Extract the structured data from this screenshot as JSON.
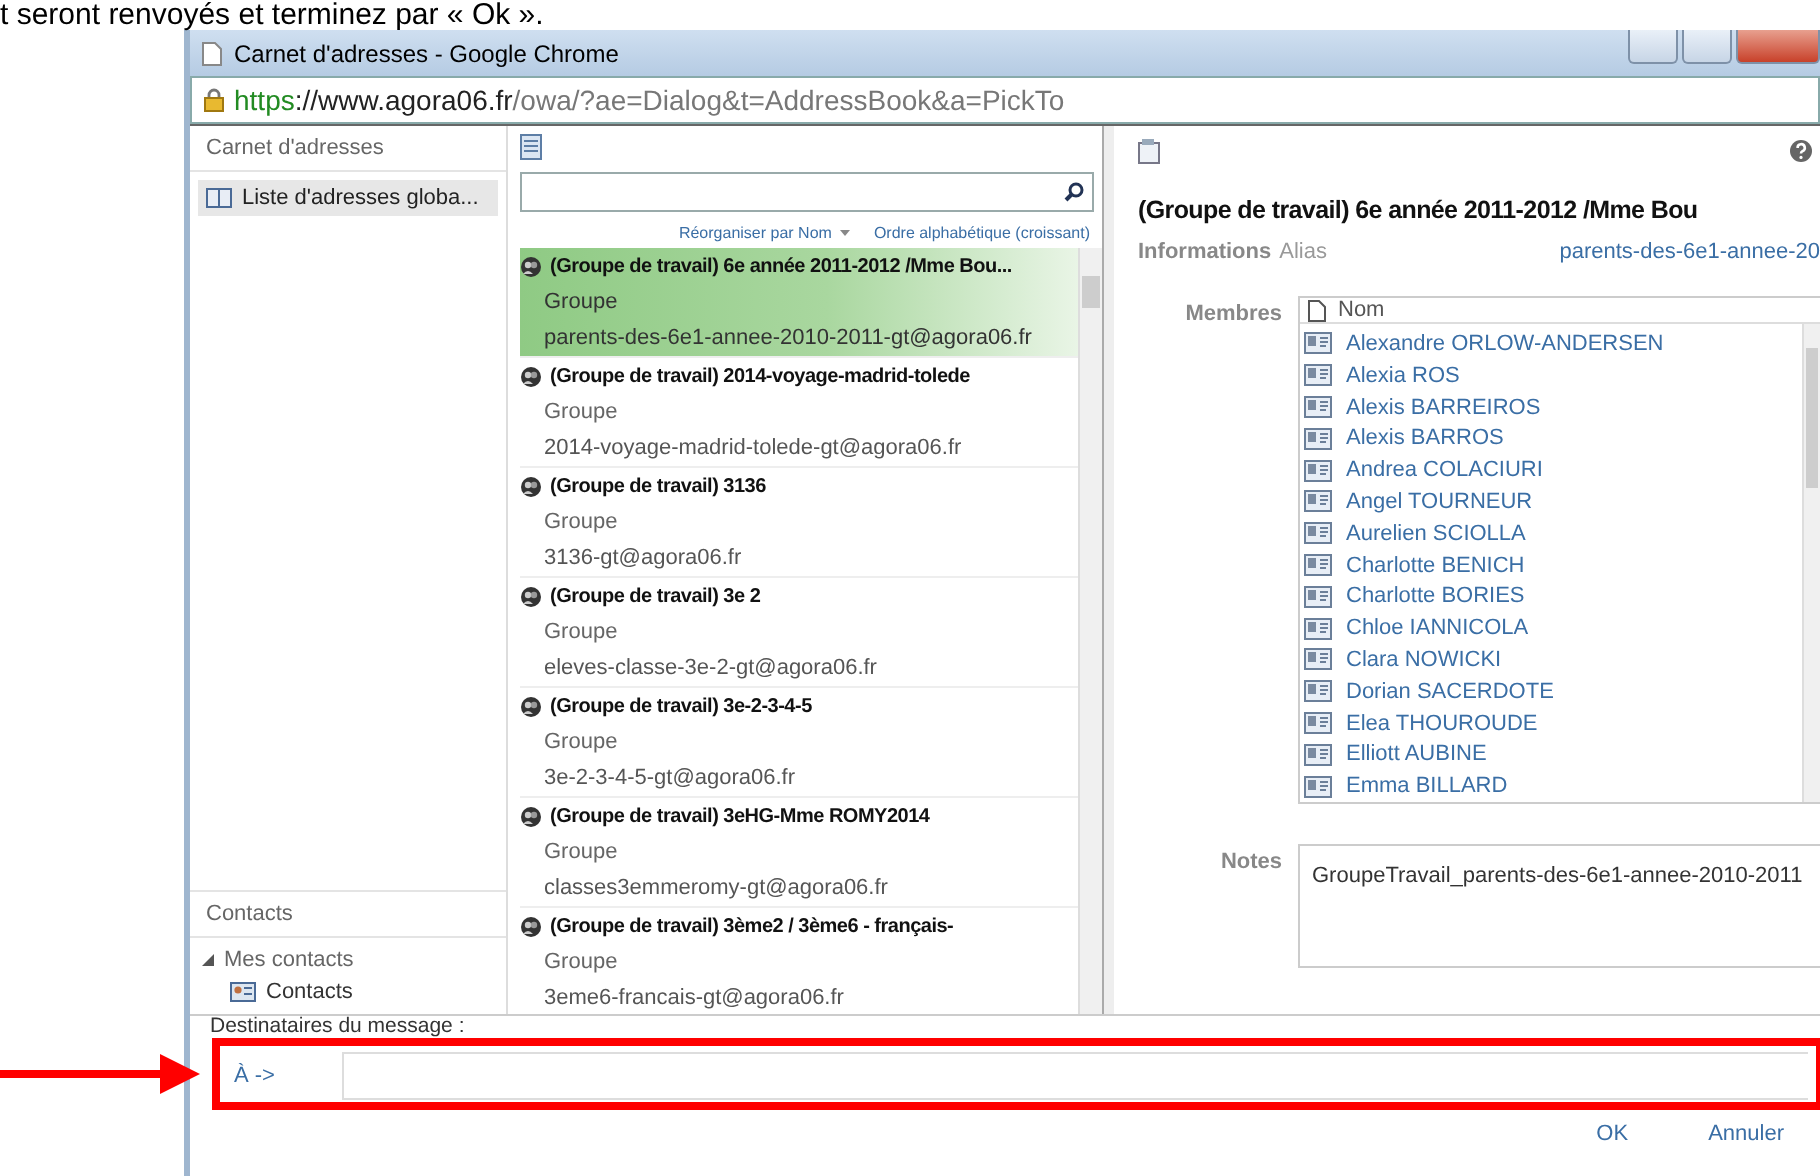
{
  "document_text": "t seront renvoyés et terminez par « Ok ».",
  "window": {
    "title": "Carnet d'adresses - Google Chrome",
    "url": {
      "scheme": "https",
      "host": "://www.agora06.fr",
      "path": "/owa/?ae=Dialog&t=AddressBook&a=PickTo"
    }
  },
  "sidebar": {
    "header": "Carnet d'adresses",
    "items": [
      {
        "label": "Liste d'adresses globa...",
        "selected": true
      }
    ],
    "contacts_header": "Contacts",
    "tree": [
      {
        "label": "Mes contacts",
        "expanded": true,
        "children": [
          {
            "label": "Contacts"
          }
        ]
      }
    ]
  },
  "list": {
    "sort_by": "Réorganiser par Nom",
    "order": "Ordre alphabétique (croissant)",
    "items": [
      {
        "name": "(Groupe de travail) 6e année 2011-2012 /Mme Bou...",
        "type": "Groupe",
        "email": "parents-des-6e1-annee-2010-2011-gt@agora06.fr",
        "selected": true
      },
      {
        "name": "(Groupe de travail) 2014-voyage-madrid-tolede",
        "type": "Groupe",
        "email": "2014-voyage-madrid-tolede-gt@agora06.fr",
        "selected": false
      },
      {
        "name": "(Groupe de travail) 3136",
        "type": "Groupe",
        "email": "3136-gt@agora06.fr",
        "selected": false
      },
      {
        "name": "(Groupe de travail) 3e 2",
        "type": "Groupe",
        "email": "eleves-classe-3e-2-gt@agora06.fr",
        "selected": false
      },
      {
        "name": "(Groupe de travail) 3e-2-3-4-5",
        "type": "Groupe",
        "email": "3e-2-3-4-5-gt@agora06.fr",
        "selected": false
      },
      {
        "name": "(Groupe de travail) 3eHG-Mme ROMY2014",
        "type": "Groupe",
        "email": "classes3emmeromy-gt@agora06.fr",
        "selected": false
      },
      {
        "name": "(Groupe de travail) 3ème2 / 3ème6 - français-",
        "type": "Groupe",
        "email": "3eme6-francais-gt@agora06.fr",
        "selected": false
      }
    ]
  },
  "details": {
    "title": "(Groupe de travail) 6e année 2011-2012 /Mme Bou",
    "info_label": "Informations",
    "alias_label": "Alias",
    "alias": "parents-des-6e1-annee-20",
    "members_label": "Membres",
    "members_column": "Nom",
    "members": [
      "Alexandre ORLOW-ANDERSEN",
      "Alexia ROS",
      "Alexis BARREIROS",
      "Alexis BARROS",
      "Andrea COLACIURI",
      "Angel TOURNEUR",
      "Aurelien SCIOLLA",
      "Charlotte BENICH",
      "Charlotte BORIES",
      "Chloe IANNICOLA",
      "Clara NOWICKI",
      "Dorian SACERDOTE",
      "Elea THOUROUDE",
      "Elliott AUBINE",
      "Emma BILLARD"
    ],
    "notes_label": "Notes",
    "notes": "GroupeTravail_parents-des-6e1-annee-2010-2011"
  },
  "recipients": {
    "label": "Destinataires du message :",
    "to": "À ->"
  },
  "buttons": [
    "OK",
    "Annuler"
  ]
}
